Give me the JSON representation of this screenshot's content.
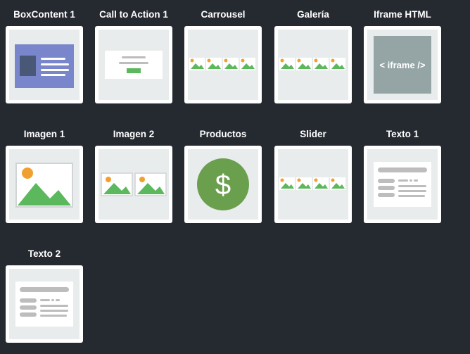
{
  "widgets": [
    {
      "label": "BoxContent 1",
      "icon": "boxcontent-icon"
    },
    {
      "label": "Call to Action 1",
      "icon": "call-to-action-icon"
    },
    {
      "label": "Carrousel",
      "icon": "carrousel-icon"
    },
    {
      "label": "Galería",
      "icon": "gallery-icon"
    },
    {
      "label": "Iframe HTML",
      "icon": "iframe-icon",
      "icon_text": "< iframe />"
    },
    {
      "label": "Imagen 1",
      "icon": "image-icon"
    },
    {
      "label": "Imagen 2",
      "icon": "two-images-icon"
    },
    {
      "label": "Productos",
      "icon": "dollar-icon",
      "icon_text": "$"
    },
    {
      "label": "Slider",
      "icon": "slider-icon"
    },
    {
      "label": "Texto 1",
      "icon": "text-block-icon"
    },
    {
      "label": "Texto 2",
      "icon": "text-block-icon"
    }
  ],
  "colors": {
    "background": "#252a31",
    "card": "#ffffff",
    "thumb_bg": "#e9ecec",
    "green": "#5cb85c",
    "sun": "#f0a030",
    "box_blue": "#7986cb",
    "box_dark": "#4a5878",
    "iframe_gray": "#95a5a6",
    "dollar_green": "#6a9f4e",
    "text_gray": "#bdbdbd"
  }
}
